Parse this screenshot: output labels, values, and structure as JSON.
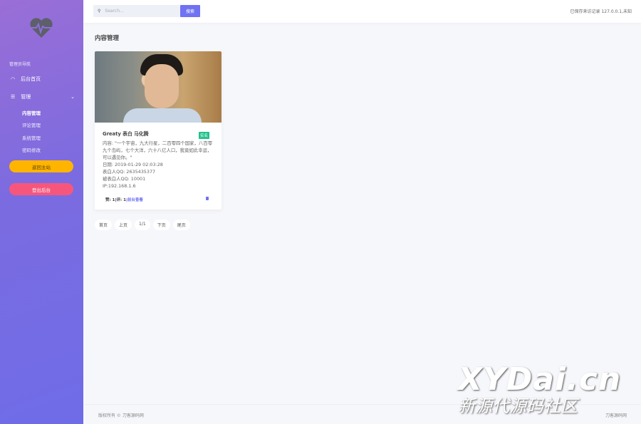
{
  "sidebar": {
    "nav_title": "管理员导航",
    "items": [
      {
        "label": "后台首页",
        "icon": "dashboard-icon"
      },
      {
        "label": "管理",
        "icon": "list-icon"
      }
    ],
    "sub_items": [
      "内容管理",
      "评论管理",
      "系统管理",
      "密码修改"
    ],
    "back_button": "返回主站",
    "logout_button": "登出后台"
  },
  "topbar": {
    "search_placeholder": "Search...",
    "search_button": "搜索",
    "visit_text": "已保存来访记录 127.0.0.1,未知"
  },
  "page_title": "内容管理",
  "card": {
    "title": "Greaty 表白 马化腾",
    "badge": "实名",
    "content": "内容: \"一个宇宙，九大行星，二百零四个国家，八百零九个岛屿，七个大洋，六十八亿人口，我竟如此幸运，可以遇见你。\"",
    "date": "日期: 2019-01-29 02:03:28",
    "from_qq": "表白人QQ: 2635435377",
    "to_qq": "被表白人QQ: 10001",
    "ip": "IP:192.168.1.6",
    "stats": "赞: 1|评: 1",
    "view_link": "|前台查看"
  },
  "pager": [
    "首页",
    "上页",
    "1/1",
    "下页",
    "尾页"
  ],
  "footer": {
    "left": "版权所有 © 刀客源码网",
    "right": "刀客源码网"
  },
  "watermark": {
    "line1": "XYDai.cn",
    "line2": "新源代源码社区"
  },
  "colors": {
    "accent": "#6f72f2",
    "badge": "#1fc18a",
    "back": "#ffb400",
    "logout": "#f7567c"
  }
}
